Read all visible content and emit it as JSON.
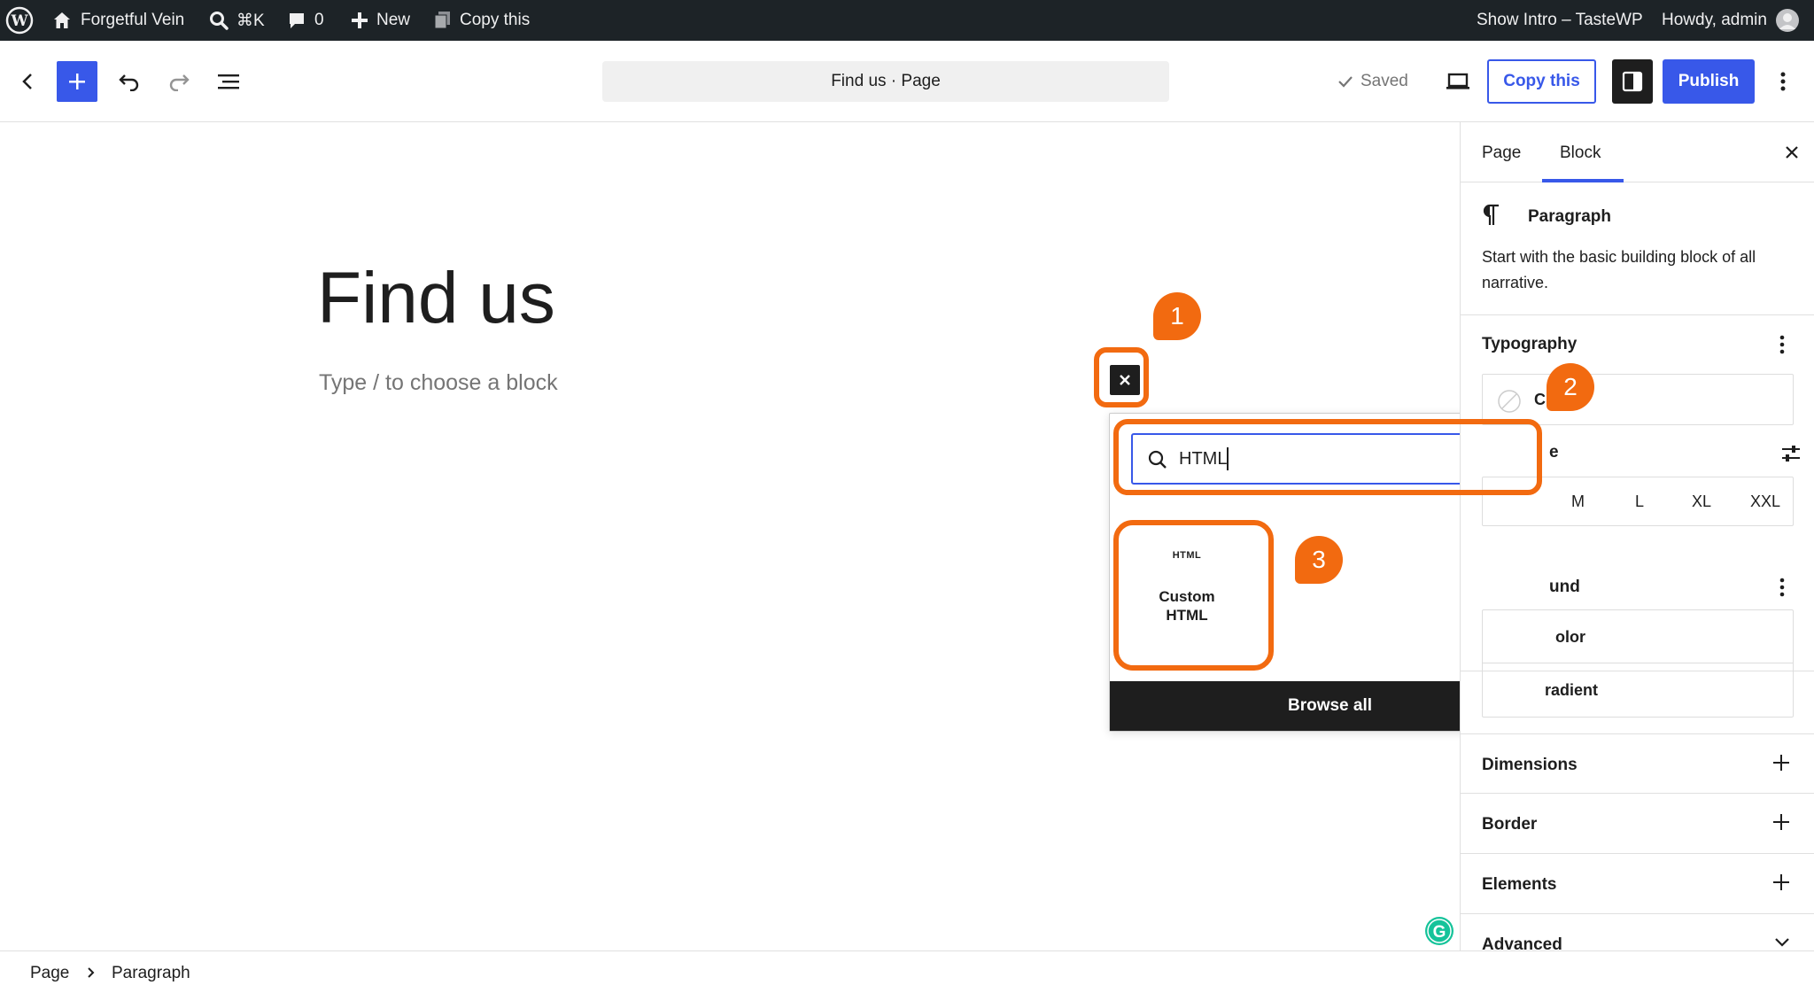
{
  "admin_bar": {
    "site_name": "Forgetful Vein",
    "search_shortcut": "⌘K",
    "comments_count": "0",
    "new_label": "New",
    "copy_label": "Copy this",
    "plugin_label": "Show Intro – TasteWP",
    "howdy": "Howdy, admin"
  },
  "header": {
    "document_title": "Find us · Page",
    "saved_label": "Saved",
    "copy_button": "Copy this",
    "publish_button": "Publish"
  },
  "canvas": {
    "page_title": "Find us",
    "placeholder": "Type / to choose a block"
  },
  "quick_inserter": {
    "search_value": "HTML",
    "block_icon_text": "HTML",
    "block_label": "Custom HTML",
    "browse_all": "Browse all"
  },
  "sidebar": {
    "tabs": [
      "Page",
      "Block"
    ],
    "active_tab": "Block",
    "block_name": "Paragraph",
    "block_description": "Start with the basic building block of all narrative.",
    "typography_label": "Typography",
    "font_size_partial": "C",
    "size_label_partial": "e",
    "sizes": [
      "M",
      "L",
      "XL",
      "XXL"
    ],
    "background_label_partial": "und",
    "color_partial": "olor",
    "gradient_partial": "radient",
    "dimensions_label": "Dimensions",
    "border_label": "Border",
    "elements_label": "Elements",
    "advanced_label": "Advanced"
  },
  "footer": {
    "breadcrumb": [
      "Page",
      "Paragraph"
    ]
  },
  "annotations": [
    "1",
    "2",
    "3"
  ],
  "colors": {
    "accent": "#3858e9",
    "annotation": "#f26a10",
    "admin_bar": "#1d2327",
    "grammarly": "#15c39a"
  }
}
